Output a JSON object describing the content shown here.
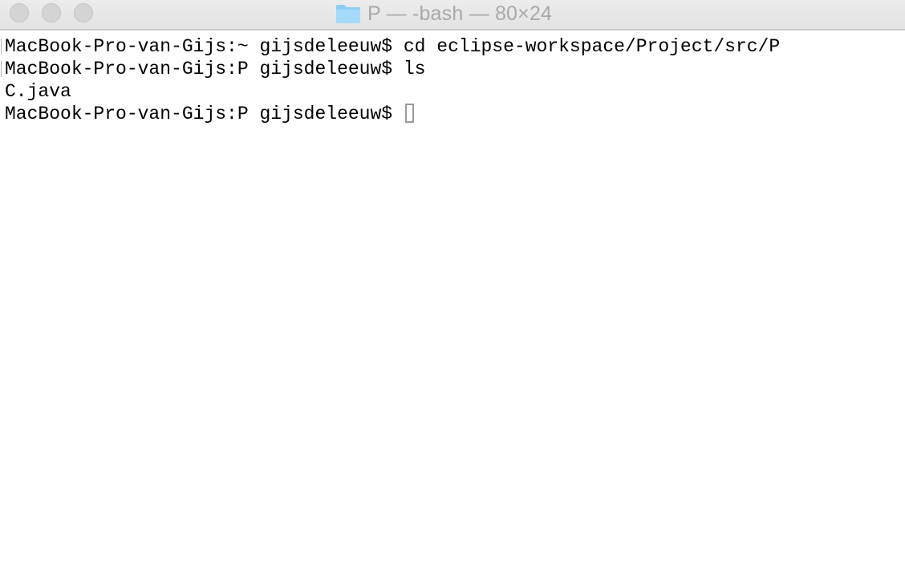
{
  "window": {
    "title": "P — -bash — 80×24",
    "icon": "folder-icon",
    "accent_color": "#8ccdf3"
  },
  "terminal": {
    "lines": [
      "MacBook-Pro-van-Gijs:~ gijsdeleeuw$ cd eclipse-workspace/Project/src/P",
      "MacBook-Pro-van-Gijs:P gijsdeleeuw$ ls",
      "C.java"
    ],
    "current_prompt": "MacBook-Pro-van-Gijs:P gijsdeleeuw$ "
  }
}
